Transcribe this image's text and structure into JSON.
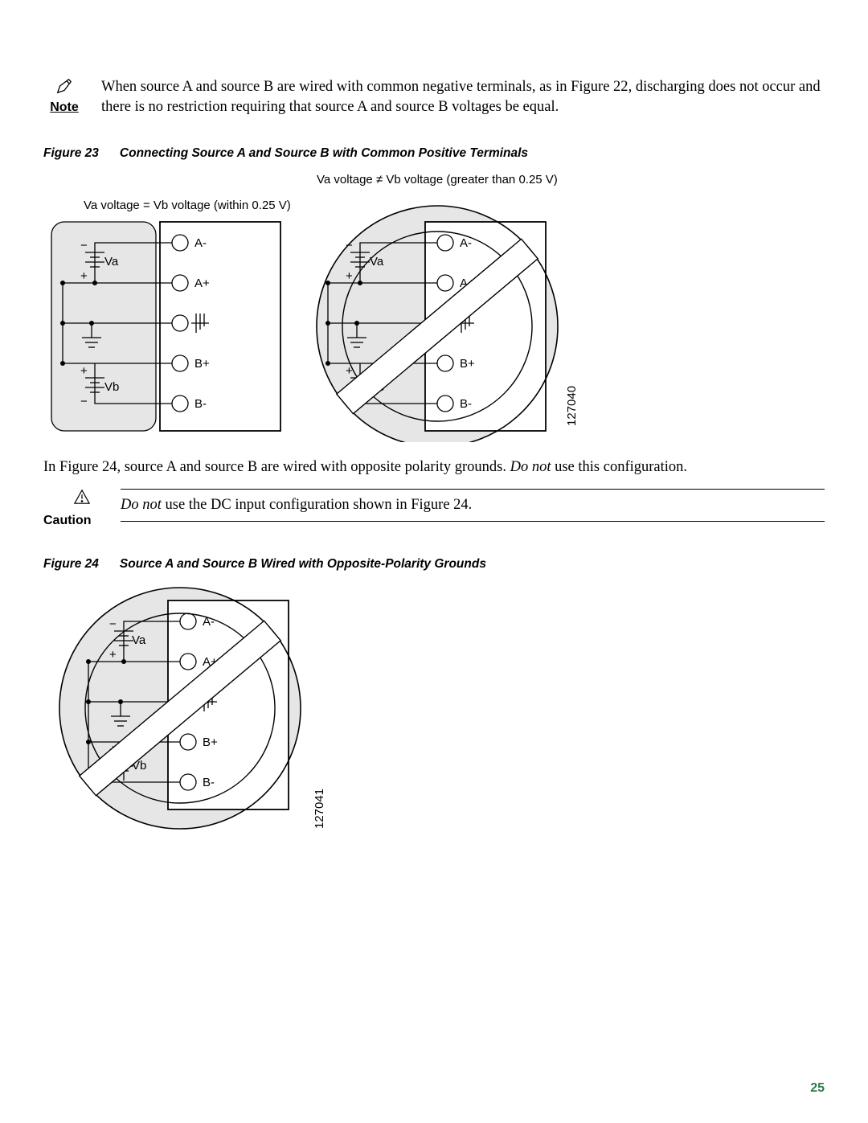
{
  "page_number": "25",
  "note": {
    "label": "Note",
    "text_before_ref": "When source A and source B are wired with common negative terminals, as in ",
    "ref": "Figure 22",
    "text_after_ref": ", discharging does not occur and there is no restriction requiring that source A and source B voltages be equal."
  },
  "figure23": {
    "label": "Figure 23",
    "title": "Connecting Source A and Source B with Common Positive Terminals",
    "left_caption": "Va voltage = Vb voltage (within 0.25 V)",
    "right_caption": "Va voltage ≠ Vb voltage (greater than 0.25 V)",
    "id": "127040",
    "labels": {
      "va": "Va",
      "vb": "Vb",
      "a_minus": "A-",
      "a_plus": "A+",
      "b_plus": "B+",
      "b_minus": "B-",
      "minus": "−",
      "plus": "+"
    }
  },
  "between_text": {
    "before_ref": "In ",
    "ref": "Figure 24",
    "middle": ", source A and source B are wired with opposite polarity grounds. ",
    "italic": "Do not",
    "after_italic": " use this configuration."
  },
  "caution": {
    "label": "Caution",
    "italic": "Do not",
    "text_after_italic": " use the DC input configuration shown in ",
    "ref": "Figure 24",
    "tail": "."
  },
  "figure24": {
    "label": "Figure 24",
    "title": "Source A and Source B Wired with Opposite-Polarity Grounds",
    "id": "127041",
    "labels": {
      "va": "Va",
      "vb": "Vb",
      "a_minus": "A-",
      "a_plus": "A+",
      "b_plus": "B+",
      "b_minus": "B-",
      "minus": "−",
      "plus": "+"
    }
  }
}
